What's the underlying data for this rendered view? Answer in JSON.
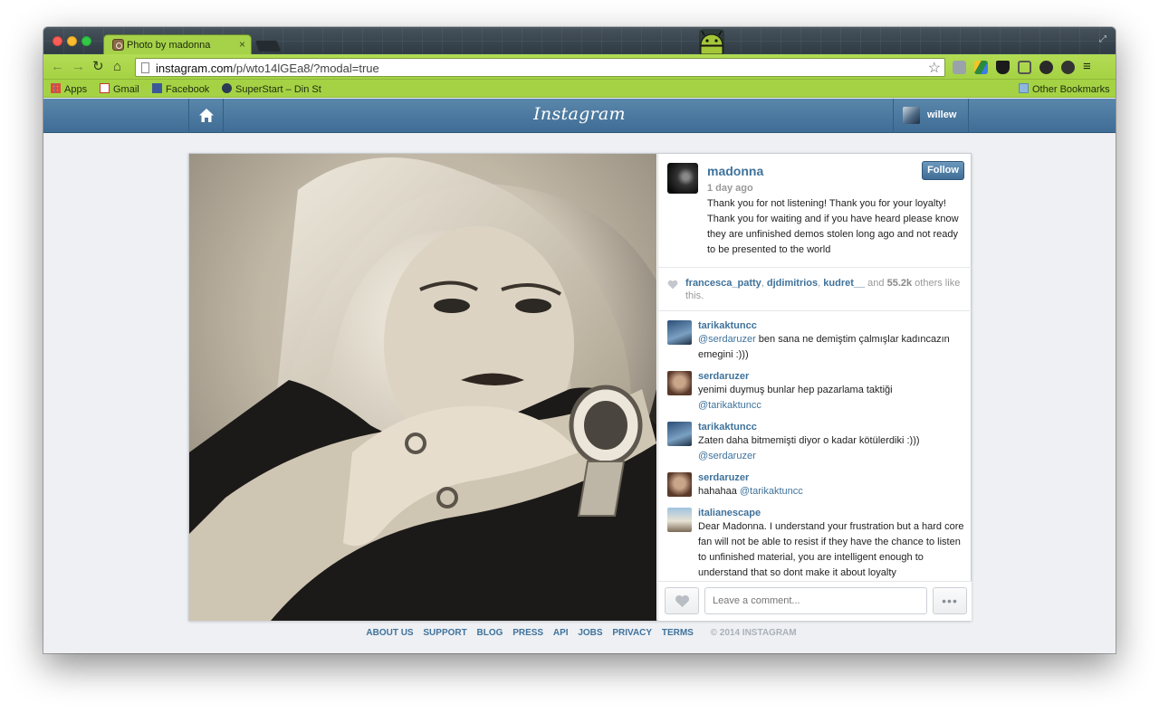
{
  "browser": {
    "tab_title": "Photo by madonna",
    "tab_close": "×",
    "url_domain": "instagram.com",
    "url_path": "/p/wto14lGEa8/?modal=true",
    "bookmarks": [
      "Apps",
      "Gmail",
      "Facebook",
      "SuperStart – Din Star"
    ],
    "other_bookmarks": "Other Bookmarks"
  },
  "header": {
    "logo": "Instagram",
    "username": "willew"
  },
  "post": {
    "author": "madonna",
    "follow_label": "Follow",
    "time": "1 day ago",
    "caption": "Thank you for not listening! Thank you for your loyalty! Thank you for waiting and if you have heard please know they are unfinished demos stolen long ago and not ready to be presented to the world",
    "likes": {
      "users": [
        "francesca_patty",
        "djdimitrios",
        "kudret__"
      ],
      "sep": ", ",
      "and": " and ",
      "count": "55.2k",
      "others": " others like this."
    },
    "comments": [
      {
        "user": "tarikaktuncc",
        "mention": "@serdaruzer",
        "text": " ben sana ne demiştim çalmışlar kadıncazın emegini :)))",
        "mention_first": true
      },
      {
        "user": "serdaruzer",
        "text": "yenimi duymuş bunlar hep pazarlama taktiği ",
        "mention": "@tarikaktuncc",
        "mention_first": false
      },
      {
        "user": "tarikaktuncc",
        "text": "Zaten daha bitmemişti diyor o kadar kötülerdiki :))) ",
        "mention": "@serdaruzer",
        "mention_first": false
      },
      {
        "user": "serdaruzer",
        "text": "hahahaa ",
        "mention": "@tarikaktuncc",
        "mention_first": false
      },
      {
        "user": "italianescape",
        "text": "Dear Madonna. I understand your frustration but a hard core fan will not be able to resist if they have the chance to listen to unfinished material, you are intelligent enough to understand that so dont make it about loyalty",
        "mention": "",
        "mention_first": false
      }
    ],
    "comment_placeholder": "Leave a comment...",
    "more_label": "•••"
  },
  "footer": {
    "links": [
      "ABOUT US",
      "SUPPORT",
      "BLOG",
      "PRESS",
      "API",
      "JOBS",
      "PRIVACY",
      "TERMS"
    ],
    "copyright": "© 2014 INSTAGRAM"
  },
  "colors": {
    "accent": "#3f729b",
    "header_blue": "#4e7ca3",
    "chrome_theme_green": "#a8d54a"
  }
}
